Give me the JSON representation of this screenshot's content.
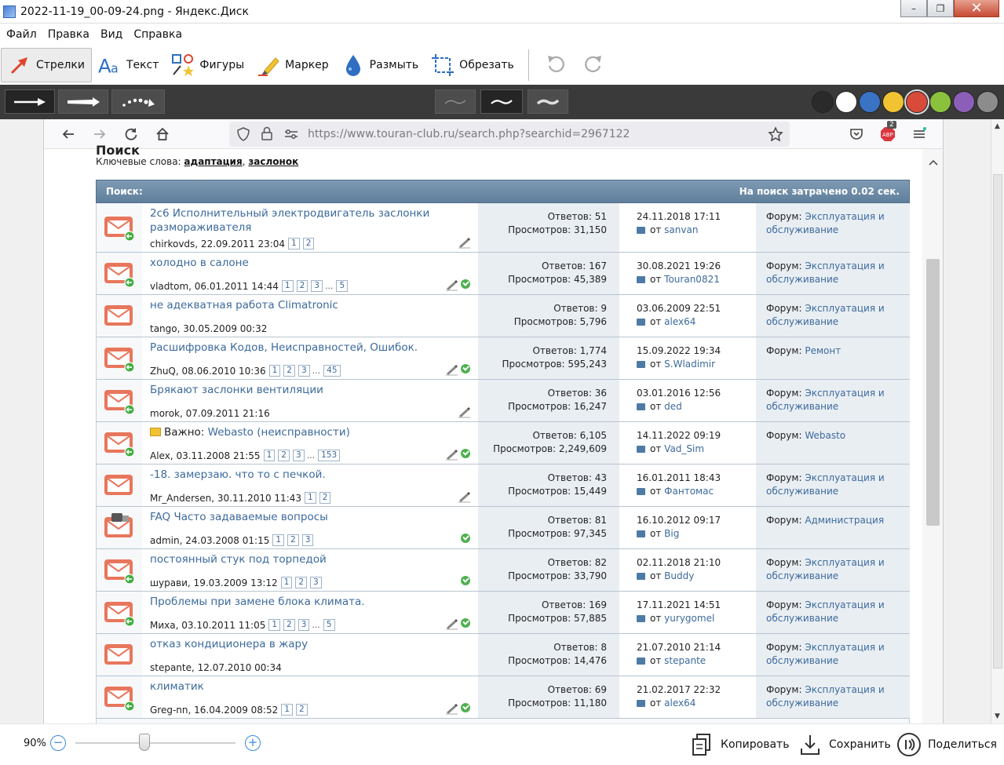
{
  "window": {
    "title": "2022-11-19_00-09-24.png - Яндекс.Диск",
    "min": "–",
    "max": "❐",
    "close": "✕"
  },
  "menu": [
    "Файл",
    "Правка",
    "Вид",
    "Справка"
  ],
  "toolbar": {
    "tools": [
      {
        "label": "Стрелки",
        "icon": "arrow-tool-icon",
        "active": true
      },
      {
        "label": "Текст",
        "icon": "text-tool-icon",
        "active": false
      },
      {
        "label": "Фигуры",
        "icon": "shapes-tool-icon",
        "active": false
      },
      {
        "label": "Маркер",
        "icon": "marker-tool-icon",
        "active": false
      },
      {
        "label": "Размыть",
        "icon": "blur-tool-icon",
        "active": false
      },
      {
        "label": "Обрезать",
        "icon": "crop-tool-icon",
        "active": false
      }
    ],
    "undo_icon": "undo-icon",
    "redo_icon": "redo-icon"
  },
  "colors": [
    "#2a2a2a",
    "#ffffff",
    "#3a72c4",
    "#f1c232",
    "#d84a3a",
    "#8ac13d",
    "#8b5fb8",
    "#8c8c8c"
  ],
  "browser": {
    "url": "https://www.touran-club.ru/search.php?searchid=2967122",
    "badge": "2"
  },
  "page": {
    "peek": "Поиск",
    "keywords_label": "Ключевые слова:",
    "keywords": [
      "адаптация",
      "заслонок"
    ],
    "header_left": "Поиск:",
    "header_right": "На поиск затрачено 0.02 сек.",
    "rows": [
      {
        "title": "2с6 Исполнительный электродвигатель заслонки размораживателя",
        "author": "chirkovds, 22.09.2011 23:04",
        "pages": [
          "1",
          "2"
        ],
        "pencil": true,
        "check": false,
        "replies": "Ответов: 51",
        "views": "Просмотров: 31,150",
        "last_date": "24.11.2018 17:11",
        "last_by": "от",
        "last_user": "sanvan",
        "forum_label": "Форум:",
        "forum": "Эксплуатация и обслуживание",
        "tall": true,
        "icon": "new"
      },
      {
        "title": "холодно в салоне",
        "author": "vladtom, 06.01.2011 14:44",
        "pages": [
          "1",
          "2",
          "3",
          "...",
          "5"
        ],
        "pencil": true,
        "check": true,
        "replies": "Ответов: 167",
        "views": "Просмотров: 45,389",
        "last_date": "30.08.2021 19:26",
        "last_by": "от",
        "last_user": "Touran0821",
        "forum_label": "Форум:",
        "forum": "Эксплуатация и обслуживание",
        "icon": "new"
      },
      {
        "title": "не адекватная работа Climatronic",
        "author": "tango, 30.05.2009 00:32",
        "pages": [],
        "pencil": false,
        "check": false,
        "replies": "Ответов: 9",
        "views": "Просмотров: 5,796",
        "last_date": "03.06.2009 22:51",
        "last_by": "от",
        "last_user": "alex64",
        "forum_label": "Форум:",
        "forum": "Эксплуатация и обслуживание",
        "icon": "plain"
      },
      {
        "title": "Расшифровка Кодов, Неисправностей, Ошибок.",
        "author": "ZhuQ, 08.06.2010 10:36",
        "pages": [
          "1",
          "2",
          "3",
          "...",
          "45"
        ],
        "pencil": true,
        "check": true,
        "replies": "Ответов: 1,774",
        "views": "Просмотров: 595,243",
        "last_date": "15.09.2022 19:34",
        "last_by": "от",
        "last_user": "S.Wladimir",
        "forum_label": "Форум:",
        "forum": "Ремонт",
        "icon": "new"
      },
      {
        "title": "Брякают заслонки вентиляции",
        "author": "morok, 07.09.2011 21:16",
        "pages": [],
        "pencil": true,
        "check": false,
        "replies": "Ответов: 36",
        "views": "Просмотров: 16,247",
        "last_date": "03.01.2016 12:56",
        "last_by": "от",
        "last_user": "ded",
        "forum_label": "Форум:",
        "forum": "Эксплуатация и обслуживание",
        "icon": "new"
      },
      {
        "prefix": "Важно:",
        "title": "Webasto (неисправности)",
        "author": "Alex, 03.11.2008 21:55",
        "pages": [
          "1",
          "2",
          "3",
          "...",
          "153"
        ],
        "pencil": true,
        "check": true,
        "replies": "Ответов: 6,105",
        "views": "Просмотров: 2,249,609",
        "last_date": "14.11.2022 09:19",
        "last_by": "от",
        "last_user": "Vad_Sim",
        "forum_label": "Форум:",
        "forum": "Webasto",
        "icon": "new"
      },
      {
        "title": "-18. замерзаю. что то с печкой.",
        "author": "Mr_Andersen, 30.11.2010 11:43",
        "pages": [
          "1",
          "2"
        ],
        "pencil": true,
        "check": false,
        "replies": "Ответов: 43",
        "views": "Просмотров: 15,449",
        "last_date": "16.01.2011 18:43",
        "last_by": "от",
        "last_user": "Фантомас",
        "forum_label": "Форум:",
        "forum": "Эксплуатация и обслуживание",
        "icon": "plain"
      },
      {
        "title": "FAQ Часто задаваемые вопросы",
        "author": "admin, 24.03.2008 01:15",
        "pages": [
          "1",
          "2",
          "3"
        ],
        "pencil": false,
        "check": true,
        "replies": "Ответов: 81",
        "views": "Просмотров: 97,345",
        "last_date": "16.10.2012 09:17",
        "last_by": "от",
        "last_user": "Big",
        "forum_label": "Форум:",
        "forum": "Администрация",
        "icon": "locked"
      },
      {
        "title": "постоянный стук под торпедой",
        "author": "шурави, 19.03.2009 13:12",
        "pages": [
          "1",
          "2",
          "3"
        ],
        "pencil": false,
        "check": true,
        "replies": "Ответов: 82",
        "views": "Просмотров: 33,790",
        "last_date": "02.11.2018 21:10",
        "last_by": "от",
        "last_user": "Buddy",
        "forum_label": "Форум:",
        "forum": "Эксплуатация и обслуживание",
        "icon": "new"
      },
      {
        "title": "Проблемы при замене блока климата.",
        "author": "Миха, 03.10.2011 11:05",
        "pages": [
          "1",
          "2",
          "3",
          "...",
          "5"
        ],
        "pencil": true,
        "check": true,
        "replies": "Ответов: 169",
        "views": "Просмотров: 57,885",
        "last_date": "17.11.2021 14:51",
        "last_by": "от",
        "last_user": "yurygomel",
        "forum_label": "Форум:",
        "forum": "Эксплуатация и обслуживание",
        "icon": "new"
      },
      {
        "title": "отказ кондиционера в жару",
        "author": "stepante, 12.07.2010 00:34",
        "pages": [],
        "pencil": false,
        "check": false,
        "replies": "Ответов: 8",
        "views": "Просмотров: 14,476",
        "last_date": "21.07.2010 21:14",
        "last_by": "от",
        "last_user": "stepante",
        "forum_label": "Форум:",
        "forum": "Эксплуатация и обслуживание",
        "icon": "plain"
      },
      {
        "title": "климатик",
        "author": "Greg-nn, 16.04.2009 08:52",
        "pages": [
          "1",
          "2"
        ],
        "pencil": true,
        "check": true,
        "replies": "Ответов: 69",
        "views": "Просмотров: 11,180",
        "last_date": "21.02.2017 22:32",
        "last_by": "от",
        "last_user": "alex64",
        "forum_label": "Форум:",
        "forum": "Эксплуатация и обслуживание",
        "icon": "new"
      }
    ]
  },
  "bottom": {
    "zoom": "90%",
    "zoom_level": 0.43,
    "copy": "Копировать",
    "save": "Сохранить",
    "share": "Поделиться"
  }
}
